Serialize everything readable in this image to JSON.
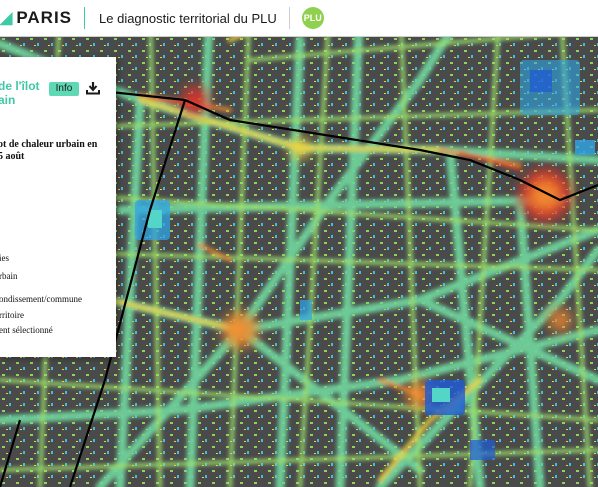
{
  "header": {
    "brand": "PARIS",
    "subtitle": "Le diagnostic territorial du PLU",
    "logo_text": "PLU"
  },
  "panel": {
    "title_line1": "de l'îlot",
    "title_line2": "ain",
    "info_label": "Info",
    "download_icon": "download-icon",
    "layer_title_line1": "ot de chaleur urbain en",
    "layer_title_line2": "5 août",
    "legend": [
      "ies",
      "rbain",
      "ondissement/commune",
      "rritoire",
      "ent sélectionné"
    ]
  },
  "colors": {
    "accent": "#3ec9a7",
    "heat_scale": [
      "#1e5bd8",
      "#2fa5e6",
      "#53d6c8",
      "#a6e05a",
      "#f0d43c",
      "#f28a2e",
      "#e4322a"
    ],
    "building": "#4a4a4a",
    "boundary": "#000000"
  }
}
